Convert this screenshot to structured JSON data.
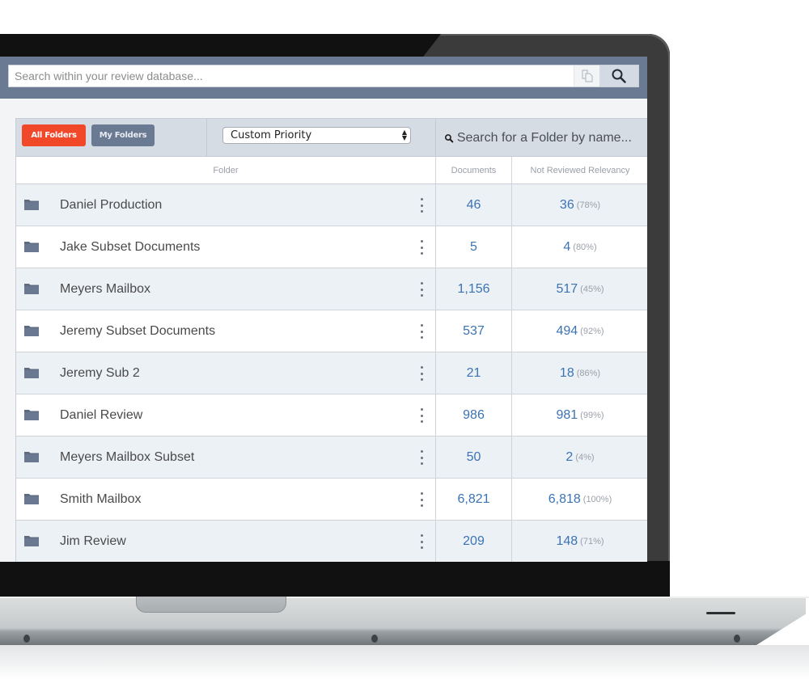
{
  "search": {
    "placeholder": "Search within your review database...",
    "copy_icon": "copy-documents-icon",
    "search_icon": "magnifier-icon"
  },
  "filters": {
    "all_folders_label": "All Folders",
    "my_folders_label": "My Folders",
    "priority_select_value": "Custom Priority",
    "folder_search_placeholder": "Search for a Folder by name...",
    "colors": {
      "all_folders": "#f2482a",
      "my_folders": "#6b7a93"
    }
  },
  "table": {
    "columns": [
      "Folder",
      "Documents",
      "Not Reviewed Relevancy"
    ],
    "rows": [
      {
        "name": "Daniel Production",
        "documents": "46",
        "not_reviewed": "36",
        "percent": "(78%)"
      },
      {
        "name": "Jake Subset Documents",
        "documents": "5",
        "not_reviewed": "4",
        "percent": "(80%)"
      },
      {
        "name": "Meyers Mailbox",
        "documents": "1,156",
        "not_reviewed": "517",
        "percent": "(45%)"
      },
      {
        "name": "Jeremy Subset Documents",
        "documents": "537",
        "not_reviewed": "494",
        "percent": "(92%)"
      },
      {
        "name": "Jeremy Sub 2",
        "documents": "21",
        "not_reviewed": "18",
        "percent": "(86%)"
      },
      {
        "name": "Daniel Review",
        "documents": "986",
        "not_reviewed": "981",
        "percent": "(99%)"
      },
      {
        "name": "Meyers Mailbox Subset",
        "documents": "50",
        "not_reviewed": "2",
        "percent": "(4%)"
      },
      {
        "name": "Smith Mailbox",
        "documents": "6,821",
        "not_reviewed": "6,818",
        "percent": "(100%)"
      },
      {
        "name": "Jim Review",
        "documents": "209",
        "not_reviewed": "148",
        "percent": "(71%)"
      }
    ]
  },
  "colors": {
    "topbar": "#6b7a93",
    "link_blue": "#3b73b3",
    "row_alt": "#ecf1f6"
  }
}
